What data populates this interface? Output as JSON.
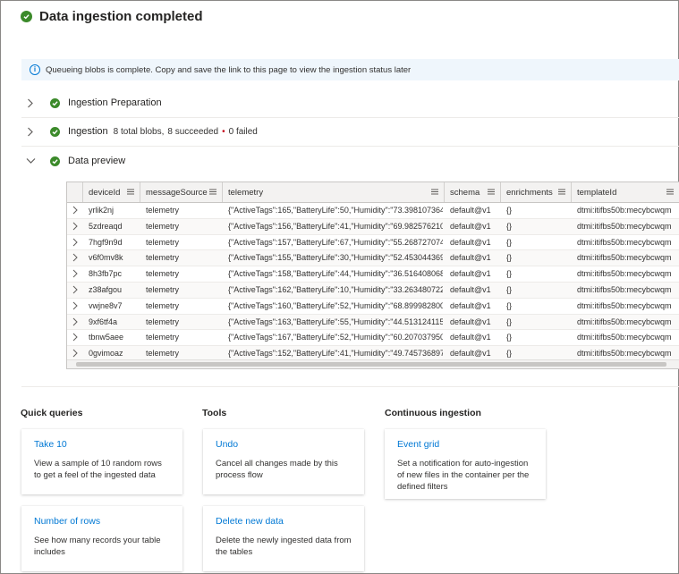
{
  "header": {
    "title": "Data ingestion completed"
  },
  "banner": {
    "text": "Queueing blobs is complete. Copy and save the link to this page to view the ingestion status later"
  },
  "steps": [
    {
      "label": "Ingestion Preparation",
      "status": "success",
      "expanded": false
    },
    {
      "label": "Ingestion",
      "status": "success",
      "expanded": false,
      "total": "8 total blobs,",
      "succeeded": "8 succeeded",
      "dot": "•",
      "failed": "0 failed"
    },
    {
      "label": "Data preview",
      "status": "success",
      "expanded": true
    }
  ],
  "grid": {
    "columns": [
      "deviceId",
      "messageSource",
      "telemetry",
      "schema",
      "enrichments",
      "templateId"
    ],
    "rows": [
      [
        "yrlik2nj",
        "telemetry",
        "{\"ActiveTags\":165,\"BatteryLife\":50,\"Humidity\":\"73.398107364...",
        "default@v1",
        "{}",
        "dtmi:itifbs50b:mecybcwqm"
      ],
      [
        "5zdreaqd",
        "telemetry",
        "{\"ActiveTags\":156,\"BatteryLife\":41,\"Humidity\":\"69.982576210...",
        "default@v1",
        "{}",
        "dtmi:itifbs50b:mecybcwqm"
      ],
      [
        "7hgf9n9d",
        "telemetry",
        "{\"ActiveTags\":157,\"BatteryLife\":67,\"Humidity\":\"55.268727074...",
        "default@v1",
        "{}",
        "dtmi:itifbs50b:mecybcwqm"
      ],
      [
        "v6f0mv8k",
        "telemetry",
        "{\"ActiveTags\":155,\"BatteryLife\":30,\"Humidity\":\"52.453044369...",
        "default@v1",
        "{}",
        "dtmi:itifbs50b:mecybcwqm"
      ],
      [
        "8h3fb7pc",
        "telemetry",
        "{\"ActiveTags\":158,\"BatteryLife\":44,\"Humidity\":\"36.516408068...",
        "default@v1",
        "{}",
        "dtmi:itifbs50b:mecybcwqm"
      ],
      [
        "z38afgou",
        "telemetry",
        "{\"ActiveTags\":162,\"BatteryLife\":10,\"Humidity\":\"33.263480722...",
        "default@v1",
        "{}",
        "dtmi:itifbs50b:mecybcwqm"
      ],
      [
        "vwjne8v7",
        "telemetry",
        "{\"ActiveTags\":160,\"BatteryLife\":52,\"Humidity\":\"68.899982800...",
        "default@v1",
        "{}",
        "dtmi:itifbs50b:mecybcwqm"
      ],
      [
        "9xf6tf4a",
        "telemetry",
        "{\"ActiveTags\":163,\"BatteryLife\":55,\"Humidity\":\"44.513124115...",
        "default@v1",
        "{}",
        "dtmi:itifbs50b:mecybcwqm"
      ],
      [
        "tbnw5aee",
        "telemetry",
        "{\"ActiveTags\":167,\"BatteryLife\":52,\"Humidity\":\"60.207037950...",
        "default@v1",
        "{}",
        "dtmi:itifbs50b:mecybcwqm"
      ],
      [
        "0gvimoaz",
        "telemetry",
        "{\"ActiveTags\":152,\"BatteryLife\":41,\"Humidity\":\"49.745736897...",
        "default@v1",
        "{}",
        "dtmi:itifbs50b:mecybcwqm"
      ]
    ]
  },
  "sections": {
    "quick_queries": {
      "heading": "Quick queries",
      "cards": [
        {
          "title": "Take 10",
          "desc": "View a sample of 10 random rows to get a feel of the ingested data"
        },
        {
          "title": "Number of rows",
          "desc": "See how many records your table includes"
        }
      ]
    },
    "tools": {
      "heading": "Tools",
      "cards": [
        {
          "title": "Undo",
          "desc": "Cancel all changes made by this process flow"
        },
        {
          "title": "Delete new data",
          "desc": "Delete the newly ingested data from the tables"
        }
      ]
    },
    "continuous": {
      "heading": "Continuous ingestion",
      "cards": [
        {
          "title": "Event grid",
          "desc": "Set a notification for auto-ingestion of new files in the container per the defined filters"
        }
      ]
    }
  },
  "colors": {
    "success": "#3b8a2a",
    "link": "#0078d4",
    "failed": "#c50f1f",
    "banner_bg": "#eff6fc"
  },
  "icons": {
    "status": "check-circle-icon",
    "info": "info-icon",
    "expand": "chevron-right-icon",
    "collapse": "chevron-down-icon",
    "column_menu": "menu-lines-icon"
  }
}
